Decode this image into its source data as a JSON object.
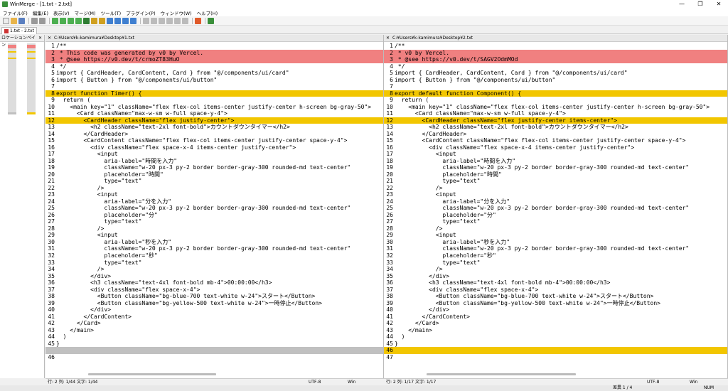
{
  "window": {
    "title": "WinMerge - [1.txt - 2.txt]"
  },
  "menu": [
    "ファイル(F)",
    "編集(E)",
    "表示(V)",
    "マージ(M)",
    "ツール(T)",
    "プラグイン(P)",
    "ウィンドウ(W)",
    "ヘルプ(H)"
  ],
  "tab": {
    "label": "1.txt - 2.txt"
  },
  "location_pane": {
    "title": "ロケーションペイン"
  },
  "left": {
    "path": "C:¥Users¥k-kamimura¥Desktop¥1.txt",
    "status_pos": "行: 2  列: 1/44  文字: 1/44",
    "encoding": "UTF-8",
    "eol": "Win",
    "lines": [
      {
        "n": "1",
        "t": "/**",
        "s": ""
      },
      {
        "n": "2",
        "t": " * This code was generated by v0 by Vercel.",
        "s": "del"
      },
      {
        "n": "3",
        "t": " * @see https://v0.dev/t/crmoZT83HuO",
        "s": "del"
      },
      {
        "n": "4",
        "t": " */",
        "s": ""
      },
      {
        "n": "5",
        "t": "import { CardHeader, CardContent, Card } from \"@/components/ui/card\"",
        "s": ""
      },
      {
        "n": "6",
        "t": "import { Button } from \"@/components/ui/button\"",
        "s": ""
      },
      {
        "n": "7",
        "t": "",
        "s": ""
      },
      {
        "n": "8",
        "t": "export function Timer() {",
        "s": "chg"
      },
      {
        "n": "9",
        "t": "  return (",
        "s": ""
      },
      {
        "n": "10",
        "t": "    <main key=\"1\" className=\"flex flex-col items-center justify-center h-screen bg-gray-50\">",
        "s": ""
      },
      {
        "n": "11",
        "t": "      <Card className=\"max-w-sm w-full space-y-4\">",
        "s": ""
      },
      {
        "n": "12",
        "t": "        <CardHeader className=\"flex justify-center\">",
        "s": "chg"
      },
      {
        "n": "13",
        "t": "          <h2 className=\"text-2xl font-bold\">カウントダウンタイマー</h2>",
        "s": ""
      },
      {
        "n": "14",
        "t": "        </CardHeader>",
        "s": ""
      },
      {
        "n": "15",
        "t": "        <CardContent className=\"flex flex-col items-center justify-center space-y-4\">",
        "s": ""
      },
      {
        "n": "16",
        "t": "          <div className=\"flex space-x-4 items-center justify-center\">",
        "s": ""
      },
      {
        "n": "17",
        "t": "            <input",
        "s": ""
      },
      {
        "n": "18",
        "t": "              aria-label=\"時間を入力\"",
        "s": ""
      },
      {
        "n": "19",
        "t": "              className=\"w-20 px-3 py-2 border border-gray-300 rounded-md text-center\"",
        "s": ""
      },
      {
        "n": "20",
        "t": "              placeholder=\"時間\"",
        "s": ""
      },
      {
        "n": "21",
        "t": "              type=\"text\"",
        "s": ""
      },
      {
        "n": "22",
        "t": "            />",
        "s": ""
      },
      {
        "n": "23",
        "t": "            <input",
        "s": ""
      },
      {
        "n": "24",
        "t": "              aria-label=\"分を入力\"",
        "s": ""
      },
      {
        "n": "25",
        "t": "              className=\"w-20 px-3 py-2 border border-gray-300 rounded-md text-center\"",
        "s": ""
      },
      {
        "n": "26",
        "t": "              placeholder=\"分\"",
        "s": ""
      },
      {
        "n": "27",
        "t": "              type=\"text\"",
        "s": ""
      },
      {
        "n": "28",
        "t": "            />",
        "s": ""
      },
      {
        "n": "29",
        "t": "            <input",
        "s": ""
      },
      {
        "n": "30",
        "t": "              aria-label=\"秒を入力\"",
        "s": ""
      },
      {
        "n": "31",
        "t": "              className=\"w-20 px-3 py-2 border border-gray-300 rounded-md text-center\"",
        "s": ""
      },
      {
        "n": "32",
        "t": "              placeholder=\"秒\"",
        "s": ""
      },
      {
        "n": "33",
        "t": "              type=\"text\"",
        "s": ""
      },
      {
        "n": "34",
        "t": "            />",
        "s": ""
      },
      {
        "n": "35",
        "t": "          </div>",
        "s": ""
      },
      {
        "n": "36",
        "t": "          <h3 className=\"text-4xl font-bold mb-4\">00:00:00</h3>",
        "s": ""
      },
      {
        "n": "37",
        "t": "          <div className=\"flex space-x-4\">",
        "s": ""
      },
      {
        "n": "38",
        "t": "            <Button className=\"bg-blue-700 text-white w-24\">スタート</Button>",
        "s": ""
      },
      {
        "n": "39",
        "t": "            <Button className=\"bg-yellow-500 text-white w-24\">一時停止</Button>",
        "s": ""
      },
      {
        "n": "40",
        "t": "          </div>",
        "s": ""
      },
      {
        "n": "41",
        "t": "        </CardContent>",
        "s": ""
      },
      {
        "n": "42",
        "t": "      </Card>",
        "s": ""
      },
      {
        "n": "43",
        "t": "    </main>",
        "s": ""
      },
      {
        "n": "44",
        "t": "  )",
        "s": ""
      },
      {
        "n": "45",
        "t": "}",
        "s": ""
      },
      {
        "n": "",
        "t": "",
        "s": "gap"
      },
      {
        "n": "46",
        "t": "",
        "s": ""
      }
    ]
  },
  "right": {
    "path": "C:¥Users¥k-kamimura¥Desktop¥2.txt",
    "status_pos": "行: 2  列: 1/17  文字: 1/17",
    "encoding": "UTF-8",
    "eol": "Win",
    "lines": [
      {
        "n": "1",
        "t": "/**",
        "s": ""
      },
      {
        "n": "2",
        "t": " * v0 by Vercel.",
        "s": "del"
      },
      {
        "n": "3",
        "t": " * @see https://v0.dev/t/SAGV2OdmMOd",
        "s": "del"
      },
      {
        "n": "4",
        "t": " */",
        "s": ""
      },
      {
        "n": "5",
        "t": "import { CardHeader, CardContent, Card } from \"@/components/ui/card\"",
        "s": ""
      },
      {
        "n": "6",
        "t": "import { Button } from \"@/components/ui/button\"",
        "s": ""
      },
      {
        "n": "7",
        "t": "",
        "s": ""
      },
      {
        "n": "8",
        "t": "export default function Component() {",
        "s": "chg"
      },
      {
        "n": "9",
        "t": "  return (",
        "s": ""
      },
      {
        "n": "10",
        "t": "    <main key=\"1\" className=\"flex flex-col items-center justify-center h-screen bg-gray-50\">",
        "s": ""
      },
      {
        "n": "11",
        "t": "      <Card className=\"max-w-sm w-full space-y-4\">",
        "s": ""
      },
      {
        "n": "12",
        "t": "        <CardHeader className=\"flex justify-center items-center\">",
        "s": "chg"
      },
      {
        "n": "13",
        "t": "          <h2 className=\"text-2xl font-bold\">カウントダウンタイマー</h2>",
        "s": ""
      },
      {
        "n": "14",
        "t": "        </CardHeader>",
        "s": ""
      },
      {
        "n": "15",
        "t": "        <CardContent className=\"flex flex-col items-center justify-center space-y-4\">",
        "s": ""
      },
      {
        "n": "16",
        "t": "          <div className=\"flex space-x-4 items-center justify-center\">",
        "s": ""
      },
      {
        "n": "17",
        "t": "            <input",
        "s": ""
      },
      {
        "n": "18",
        "t": "              aria-label=\"時間を入力\"",
        "s": ""
      },
      {
        "n": "19",
        "t": "              className=\"w-20 px-3 py-2 border border-gray-300 rounded-md text-center\"",
        "s": ""
      },
      {
        "n": "20",
        "t": "              placeholder=\"時間\"",
        "s": ""
      },
      {
        "n": "21",
        "t": "              type=\"text\"",
        "s": ""
      },
      {
        "n": "22",
        "t": "            />",
        "s": ""
      },
      {
        "n": "23",
        "t": "            <input",
        "s": ""
      },
      {
        "n": "24",
        "t": "              aria-label=\"分を入力\"",
        "s": ""
      },
      {
        "n": "25",
        "t": "              className=\"w-20 px-3 py-2 border border-gray-300 rounded-md text-center\"",
        "s": ""
      },
      {
        "n": "26",
        "t": "              placeholder=\"分\"",
        "s": ""
      },
      {
        "n": "27",
        "t": "              type=\"text\"",
        "s": ""
      },
      {
        "n": "28",
        "t": "            />",
        "s": ""
      },
      {
        "n": "29",
        "t": "            <input",
        "s": ""
      },
      {
        "n": "30",
        "t": "              aria-label=\"秒を入力\"",
        "s": ""
      },
      {
        "n": "31",
        "t": "              className=\"w-20 px-3 py-2 border border-gray-300 rounded-md text-center\"",
        "s": ""
      },
      {
        "n": "32",
        "t": "              placeholder=\"秒\"",
        "s": ""
      },
      {
        "n": "33",
        "t": "              type=\"text\"",
        "s": ""
      },
      {
        "n": "34",
        "t": "            />",
        "s": ""
      },
      {
        "n": "35",
        "t": "          </div>",
        "s": ""
      },
      {
        "n": "36",
        "t": "          <h3 className=\"text-4xl font-bold mb-4\">00:00:00</h3>",
        "s": ""
      },
      {
        "n": "37",
        "t": "          <div className=\"flex space-x-4\">",
        "s": ""
      },
      {
        "n": "38",
        "t": "            <Button className=\"bg-blue-700 text-white w-24\">スタート</Button>",
        "s": ""
      },
      {
        "n": "39",
        "t": "            <Button className=\"bg-yellow-500 text-white w-24\">一時停止</Button>",
        "s": ""
      },
      {
        "n": "40",
        "t": "          </div>",
        "s": ""
      },
      {
        "n": "41",
        "t": "        </CardContent>",
        "s": ""
      },
      {
        "n": "42",
        "t": "      </Card>",
        "s": ""
      },
      {
        "n": "43",
        "t": "    </main>",
        "s": ""
      },
      {
        "n": "44",
        "t": "  )",
        "s": ""
      },
      {
        "n": "45",
        "t": "}",
        "s": ""
      },
      {
        "n": "46",
        "t": "",
        "s": "add"
      },
      {
        "n": "47",
        "t": "",
        "s": ""
      }
    ]
  },
  "statusbar": {
    "diff": "差異 1 / 4",
    "num": "NUM"
  },
  "colors": {
    "deleted": "#f08080",
    "changed": "#f2c600",
    "gap": "#c0c0c0"
  }
}
